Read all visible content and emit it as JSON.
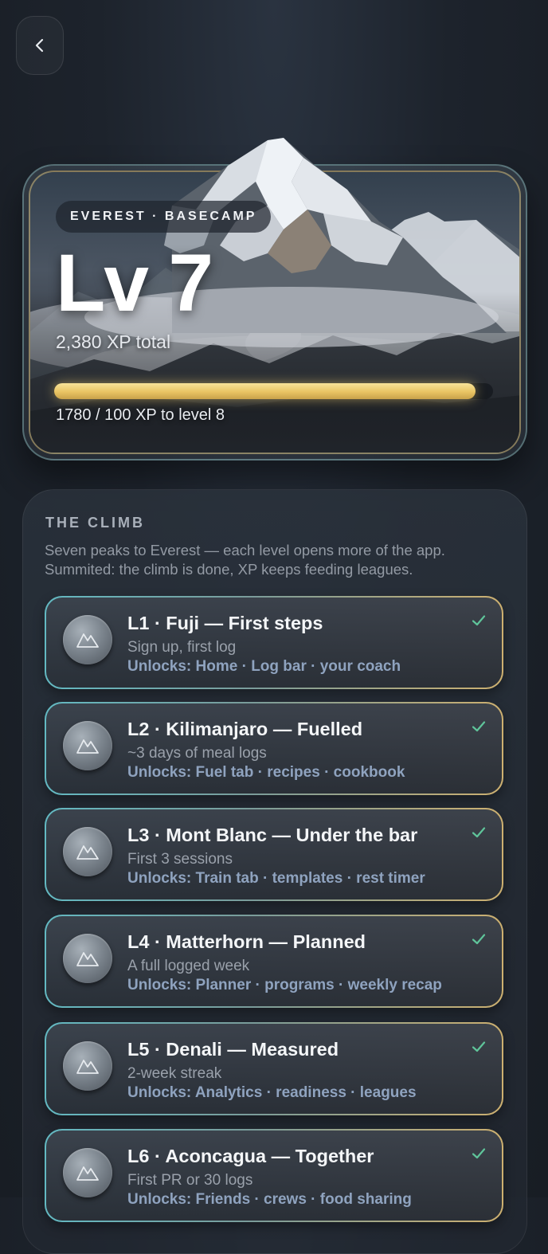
{
  "nav": {
    "back_icon": "chevron-left-icon"
  },
  "hero": {
    "badge": "EVEREST · BASECAMP",
    "level_title": "Lv 7",
    "xp_total": "2,380 XP total",
    "progress_fraction": 0.96,
    "xp_to_next": "1780 / 100 XP to level 8",
    "progress_color": "#e9c463"
  },
  "climb": {
    "title": "THE CLIMB",
    "description_line1": "Seven peaks to Everest — each level opens more of the app.",
    "description_line2": "Summited: the climb is done, XP keeps feeding leagues.",
    "check_color": "#5fc49a",
    "levels": [
      {
        "name": "L1 · Fuji — First steps",
        "requirement": "Sign up, first log",
        "unlocks": "Unlocks: Home · Log bar · your coach",
        "completed": true,
        "icon": "mountain-icon"
      },
      {
        "name": "L2 · Kilimanjaro — Fuelled",
        "requirement": "~3 days of meal logs",
        "unlocks": "Unlocks: Fuel tab · recipes · cookbook",
        "completed": true,
        "icon": "mountain-icon"
      },
      {
        "name": "L3 · Mont Blanc — Under the bar",
        "requirement": "First 3 sessions",
        "unlocks": "Unlocks: Train tab · templates · rest timer",
        "completed": true,
        "icon": "mountain-icon"
      },
      {
        "name": "L4 · Matterhorn — Planned",
        "requirement": "A full logged week",
        "unlocks": "Unlocks: Planner · programs · weekly recap",
        "completed": true,
        "icon": "mountain-icon"
      },
      {
        "name": "L5 · Denali — Measured",
        "requirement": "2-week streak",
        "unlocks": "Unlocks: Analytics · readiness · leagues",
        "completed": true,
        "icon": "mountain-icon"
      },
      {
        "name": "L6 · Aconcagua — Together",
        "requirement": "First PR or 30 logs",
        "unlocks": "Unlocks: Friends · crews · food sharing",
        "completed": true,
        "icon": "mountain-icon"
      }
    ]
  }
}
